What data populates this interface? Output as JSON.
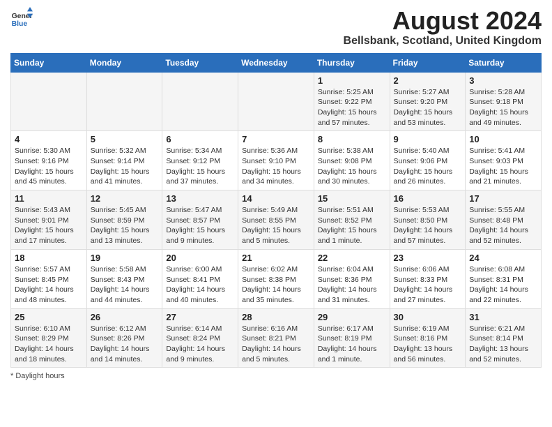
{
  "header": {
    "logo_line1": "General",
    "logo_line2": "Blue",
    "title": "August 2024",
    "subtitle": "Bellsbank, Scotland, United Kingdom"
  },
  "days_of_week": [
    "Sunday",
    "Monday",
    "Tuesday",
    "Wednesday",
    "Thursday",
    "Friday",
    "Saturday"
  ],
  "weeks": [
    [
      {
        "day": "",
        "sunrise": "",
        "sunset": "",
        "daylight": ""
      },
      {
        "day": "",
        "sunrise": "",
        "sunset": "",
        "daylight": ""
      },
      {
        "day": "",
        "sunrise": "",
        "sunset": "",
        "daylight": ""
      },
      {
        "day": "",
        "sunrise": "",
        "sunset": "",
        "daylight": ""
      },
      {
        "day": "1",
        "sunrise": "Sunrise: 5:25 AM",
        "sunset": "Sunset: 9:22 PM",
        "daylight": "Daylight: 15 hours and 57 minutes."
      },
      {
        "day": "2",
        "sunrise": "Sunrise: 5:27 AM",
        "sunset": "Sunset: 9:20 PM",
        "daylight": "Daylight: 15 hours and 53 minutes."
      },
      {
        "day": "3",
        "sunrise": "Sunrise: 5:28 AM",
        "sunset": "Sunset: 9:18 PM",
        "daylight": "Daylight: 15 hours and 49 minutes."
      }
    ],
    [
      {
        "day": "4",
        "sunrise": "Sunrise: 5:30 AM",
        "sunset": "Sunset: 9:16 PM",
        "daylight": "Daylight: 15 hours and 45 minutes."
      },
      {
        "day": "5",
        "sunrise": "Sunrise: 5:32 AM",
        "sunset": "Sunset: 9:14 PM",
        "daylight": "Daylight: 15 hours and 41 minutes."
      },
      {
        "day": "6",
        "sunrise": "Sunrise: 5:34 AM",
        "sunset": "Sunset: 9:12 PM",
        "daylight": "Daylight: 15 hours and 37 minutes."
      },
      {
        "day": "7",
        "sunrise": "Sunrise: 5:36 AM",
        "sunset": "Sunset: 9:10 PM",
        "daylight": "Daylight: 15 hours and 34 minutes."
      },
      {
        "day": "8",
        "sunrise": "Sunrise: 5:38 AM",
        "sunset": "Sunset: 9:08 PM",
        "daylight": "Daylight: 15 hours and 30 minutes."
      },
      {
        "day": "9",
        "sunrise": "Sunrise: 5:40 AM",
        "sunset": "Sunset: 9:06 PM",
        "daylight": "Daylight: 15 hours and 26 minutes."
      },
      {
        "day": "10",
        "sunrise": "Sunrise: 5:41 AM",
        "sunset": "Sunset: 9:03 PM",
        "daylight": "Daylight: 15 hours and 21 minutes."
      }
    ],
    [
      {
        "day": "11",
        "sunrise": "Sunrise: 5:43 AM",
        "sunset": "Sunset: 9:01 PM",
        "daylight": "Daylight: 15 hours and 17 minutes."
      },
      {
        "day": "12",
        "sunrise": "Sunrise: 5:45 AM",
        "sunset": "Sunset: 8:59 PM",
        "daylight": "Daylight: 15 hours and 13 minutes."
      },
      {
        "day": "13",
        "sunrise": "Sunrise: 5:47 AM",
        "sunset": "Sunset: 8:57 PM",
        "daylight": "Daylight: 15 hours and 9 minutes."
      },
      {
        "day": "14",
        "sunrise": "Sunrise: 5:49 AM",
        "sunset": "Sunset: 8:55 PM",
        "daylight": "Daylight: 15 hours and 5 minutes."
      },
      {
        "day": "15",
        "sunrise": "Sunrise: 5:51 AM",
        "sunset": "Sunset: 8:52 PM",
        "daylight": "Daylight: 15 hours and 1 minute."
      },
      {
        "day": "16",
        "sunrise": "Sunrise: 5:53 AM",
        "sunset": "Sunset: 8:50 PM",
        "daylight": "Daylight: 14 hours and 57 minutes."
      },
      {
        "day": "17",
        "sunrise": "Sunrise: 5:55 AM",
        "sunset": "Sunset: 8:48 PM",
        "daylight": "Daylight: 14 hours and 52 minutes."
      }
    ],
    [
      {
        "day": "18",
        "sunrise": "Sunrise: 5:57 AM",
        "sunset": "Sunset: 8:45 PM",
        "daylight": "Daylight: 14 hours and 48 minutes."
      },
      {
        "day": "19",
        "sunrise": "Sunrise: 5:58 AM",
        "sunset": "Sunset: 8:43 PM",
        "daylight": "Daylight: 14 hours and 44 minutes."
      },
      {
        "day": "20",
        "sunrise": "Sunrise: 6:00 AM",
        "sunset": "Sunset: 8:41 PM",
        "daylight": "Daylight: 14 hours and 40 minutes."
      },
      {
        "day": "21",
        "sunrise": "Sunrise: 6:02 AM",
        "sunset": "Sunset: 8:38 PM",
        "daylight": "Daylight: 14 hours and 35 minutes."
      },
      {
        "day": "22",
        "sunrise": "Sunrise: 6:04 AM",
        "sunset": "Sunset: 8:36 PM",
        "daylight": "Daylight: 14 hours and 31 minutes."
      },
      {
        "day": "23",
        "sunrise": "Sunrise: 6:06 AM",
        "sunset": "Sunset: 8:33 PM",
        "daylight": "Daylight: 14 hours and 27 minutes."
      },
      {
        "day": "24",
        "sunrise": "Sunrise: 6:08 AM",
        "sunset": "Sunset: 8:31 PM",
        "daylight": "Daylight: 14 hours and 22 minutes."
      }
    ],
    [
      {
        "day": "25",
        "sunrise": "Sunrise: 6:10 AM",
        "sunset": "Sunset: 8:29 PM",
        "daylight": "Daylight: 14 hours and 18 minutes."
      },
      {
        "day": "26",
        "sunrise": "Sunrise: 6:12 AM",
        "sunset": "Sunset: 8:26 PM",
        "daylight": "Daylight: 14 hours and 14 minutes."
      },
      {
        "day": "27",
        "sunrise": "Sunrise: 6:14 AM",
        "sunset": "Sunset: 8:24 PM",
        "daylight": "Daylight: 14 hours and 9 minutes."
      },
      {
        "day": "28",
        "sunrise": "Sunrise: 6:16 AM",
        "sunset": "Sunset: 8:21 PM",
        "daylight": "Daylight: 14 hours and 5 minutes."
      },
      {
        "day": "29",
        "sunrise": "Sunrise: 6:17 AM",
        "sunset": "Sunset: 8:19 PM",
        "daylight": "Daylight: 14 hours and 1 minute."
      },
      {
        "day": "30",
        "sunrise": "Sunrise: 6:19 AM",
        "sunset": "Sunset: 8:16 PM",
        "daylight": "Daylight: 13 hours and 56 minutes."
      },
      {
        "day": "31",
        "sunrise": "Sunrise: 6:21 AM",
        "sunset": "Sunset: 8:14 PM",
        "daylight": "Daylight: 13 hours and 52 minutes."
      }
    ]
  ],
  "footer": {
    "note": "Daylight hours"
  },
  "colors": {
    "header_bg": "#2a6ebb",
    "header_text": "#ffffff",
    "odd_row_bg": "#f5f5f5",
    "even_row_bg": "#ffffff"
  }
}
